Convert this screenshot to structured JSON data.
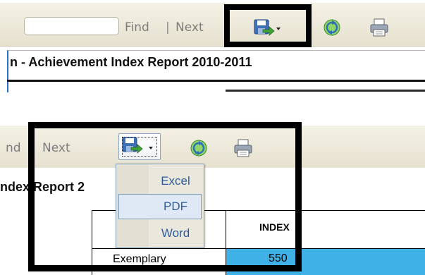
{
  "panel1": {
    "search": {
      "value": "",
      "placeholder": ""
    },
    "find_label": "Find",
    "separator": "|",
    "next_label": "Next",
    "report_title": "n - Achievement Index Report 2010-2011"
  },
  "panel2": {
    "find_label": "nd",
    "next_label": "Next",
    "report_title": "ndex Report 2",
    "export_menu": {
      "items": [
        {
          "label": "Excel"
        },
        {
          "label": "PDF",
          "hovered": true
        },
        {
          "label": "Word"
        }
      ]
    },
    "table": {
      "column_header": "INDEX",
      "row_label": "Exemplary",
      "cell_value": "550",
      "cell_color": "#3fb1e6"
    }
  },
  "icons": {
    "export": "save-export-icon",
    "dropdown_arrow": "chevron-down-icon",
    "refresh": "refresh-icon",
    "print": "printer-icon"
  },
  "colors": {
    "toolbar_bg": "#ece8d8",
    "link_text": "#7d7d7d",
    "menu_text": "#2f5c9a",
    "highlight_box": "#000000",
    "report_border": "#2b6fc9"
  }
}
